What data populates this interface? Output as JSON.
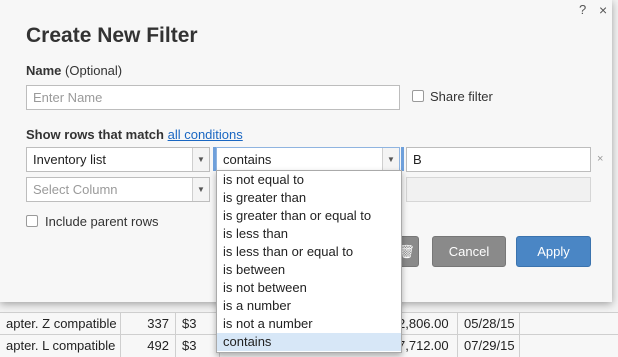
{
  "background": {
    "rows": [
      [
        "apter. Z compatible",
        "337",
        "$3",
        "2,806.00",
        "05/28/15"
      ],
      [
        "apter. L compatible",
        "492",
        "$3",
        "7,712.00",
        "07/29/15"
      ]
    ]
  },
  "dialog": {
    "title": "Create New Filter",
    "help_label": "?",
    "close_label": "×",
    "name_label": "Name",
    "name_optional": "(Optional)",
    "name_placeholder": "Enter Name",
    "name_value": "",
    "share_filter_label": "Share filter",
    "match_label": "Show rows that match",
    "match_link": "all conditions",
    "condition_row": {
      "column": "Inventory list",
      "operator": "contains",
      "value": "B",
      "remove_label": "×"
    },
    "select_column_placeholder": "Select Column",
    "include_parent_label": "Include parent rows",
    "cancel_label": "Cancel",
    "apply_label": "Apply"
  },
  "operator_dropdown": {
    "options": [
      "is not equal to",
      "is greater than",
      "is greater than or equal to",
      "is less than",
      "is less than or equal to",
      "is between",
      "is not between",
      "is a number",
      "is not a number",
      "contains"
    ],
    "selected": "contains"
  },
  "colors": {
    "accent": "#4a86c5",
    "link": "#1a67c2",
    "selected_option": "#d7e7f7"
  }
}
